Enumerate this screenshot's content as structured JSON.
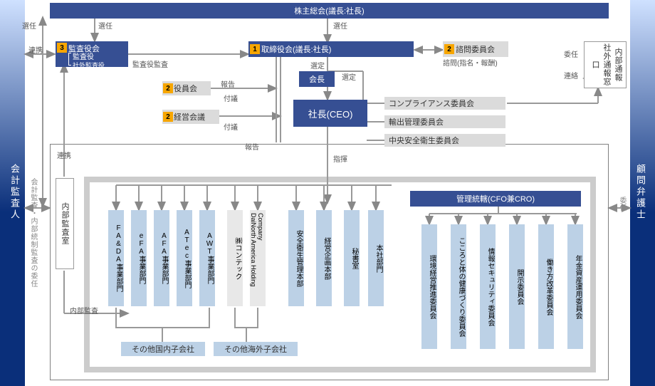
{
  "top": {
    "shareholders": "株主総会(議長:社長)",
    "board": "取締役会(議長:社長)",
    "advisory": "諮問委員会",
    "chairman": "会長",
    "ceo": "社長(CEO)",
    "audit_committee": "監査役会",
    "audit_inner1": "監査役",
    "audit_inner2": "社外監査役",
    "officers": "役員会",
    "mgmt_meeting": "経営会議",
    "admin": "管理統轄(CFO兼CRO)"
  },
  "committees": {
    "compliance": "コンプライアンス委員会",
    "export": "輸出管理委員会",
    "safety": "中央安全衛生委員会"
  },
  "right": {
    "whistle": "社外通報窓口",
    "internal_report": "内部通報",
    "legal": "顧問弁護士"
  },
  "left": {
    "accountant": "会計監査人",
    "internal_audit_office": "内部監査室",
    "audit_scope": "会計監査・内部統制監査の委任"
  },
  "labels": {
    "appoint": "選任",
    "select": "選定",
    "coop": "連携",
    "audit": "監査役監査",
    "report": "報告",
    "refer": "付議",
    "consult": "諮問(指名・報酬)",
    "delegate": "委任",
    "contact": "連絡",
    "command": "指揮",
    "int_audit": "内部監査"
  },
  "depts": [
    "FA&DA事業部門",
    "eFA事業部門",
    "AFA事業部門",
    "ATec事業部門",
    "AWT事業部門",
    "㈱コンテック",
    "DaiNorth America Holding Company",
    "安全衛生管理本部",
    "経営企画本部",
    "秘書室",
    "本社部門"
  ],
  "cro_committees": [
    "環境経営推進委員会",
    "こころと体の健康づくり委員会",
    "情報セキュリティ委員会",
    "開示委員会",
    "働き方改革委員会",
    "年金資産運用委員会"
  ],
  "subsidiaries": {
    "domestic": "その他国内子会社",
    "overseas": "その他海外子会社"
  }
}
